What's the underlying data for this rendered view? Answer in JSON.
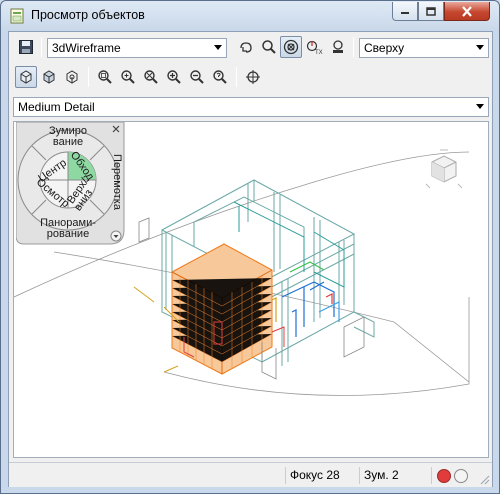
{
  "window": {
    "title": "Просмотр объектов"
  },
  "toolbar": {
    "visual_style": "3dWireframe",
    "view_direction": "Сверху",
    "detail_level": "Medium Detail"
  },
  "nav_wheel": {
    "zoom": [
      "Зумиро",
      "вание"
    ],
    "orbit": "Обход",
    "rewind": "Перемотка",
    "center": "Центр",
    "look": "Осмотр",
    "up_down": [
      "Верх/",
      "вниз"
    ],
    "pan": [
      "Панорами-",
      "рование"
    ]
  },
  "status": {
    "focus": "Фокус 28",
    "zoom": "Зум. 2"
  },
  "colors": {
    "accent_red": "#e03c3c",
    "wheel_green": "#8ed8a2",
    "model_orange": "#f07a1a",
    "model_teal": "#2a9d9a"
  }
}
